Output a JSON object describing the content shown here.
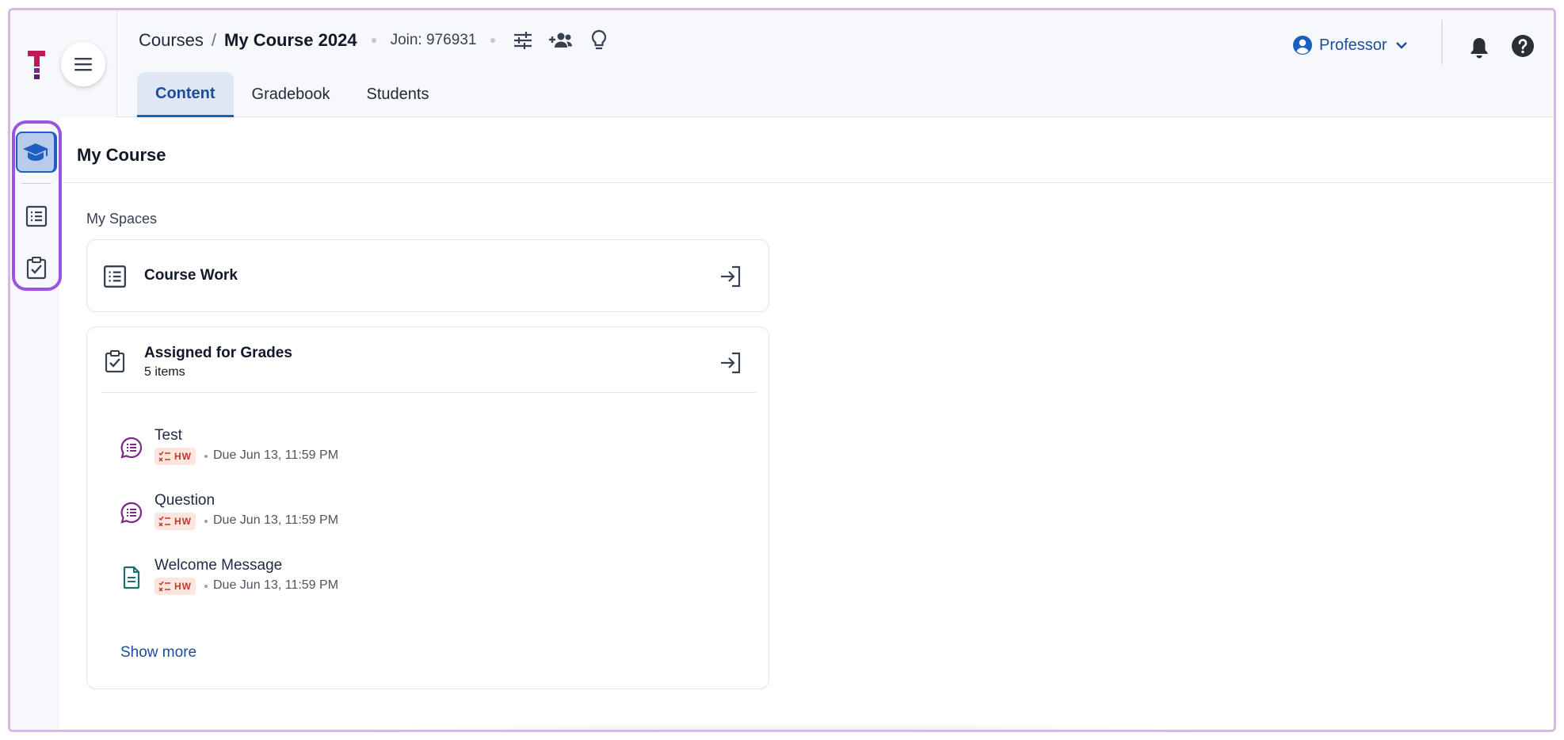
{
  "header": {
    "breadcrumb": {
      "root": "Courses",
      "separator": "/",
      "current": "My Course 2024"
    },
    "join_code": "Join: 976931",
    "tabs": [
      {
        "label": "Content",
        "active": true
      },
      {
        "label": "Gradebook",
        "active": false
      },
      {
        "label": "Students",
        "active": false
      }
    ],
    "role": "Professor"
  },
  "rail": {
    "items": [
      {
        "icon": "graduation-cap-icon",
        "active": true
      },
      {
        "icon": "list-icon",
        "active": false
      },
      {
        "icon": "clipboard-check-icon",
        "active": false
      }
    ]
  },
  "main": {
    "title": "My Course",
    "section_label": "My Spaces",
    "course_work": {
      "title": "Course Work"
    },
    "assigned": {
      "title": "Assigned for Grades",
      "count": "5 items",
      "items": [
        {
          "title": "Test",
          "badge": "HW",
          "due": "Due Jun 13, 11:59 PM",
          "icon": "discussion-icon"
        },
        {
          "title": "Question",
          "badge": "HW",
          "due": "Due Jun 13, 11:59 PM",
          "icon": "discussion-icon"
        },
        {
          "title": "Welcome Message",
          "badge": "HW",
          "due": "Due Jun 13, 11:59 PM",
          "icon": "document-icon"
        }
      ],
      "show_more": "Show more"
    }
  },
  "colors": {
    "accent": "#1b5fbf",
    "highlight": "#9a55e0",
    "badge_bg": "#fde6de",
    "badge_text": "#c0392b",
    "discussion_icon": "#7b2a86",
    "document_icon": "#1d6f6b"
  }
}
